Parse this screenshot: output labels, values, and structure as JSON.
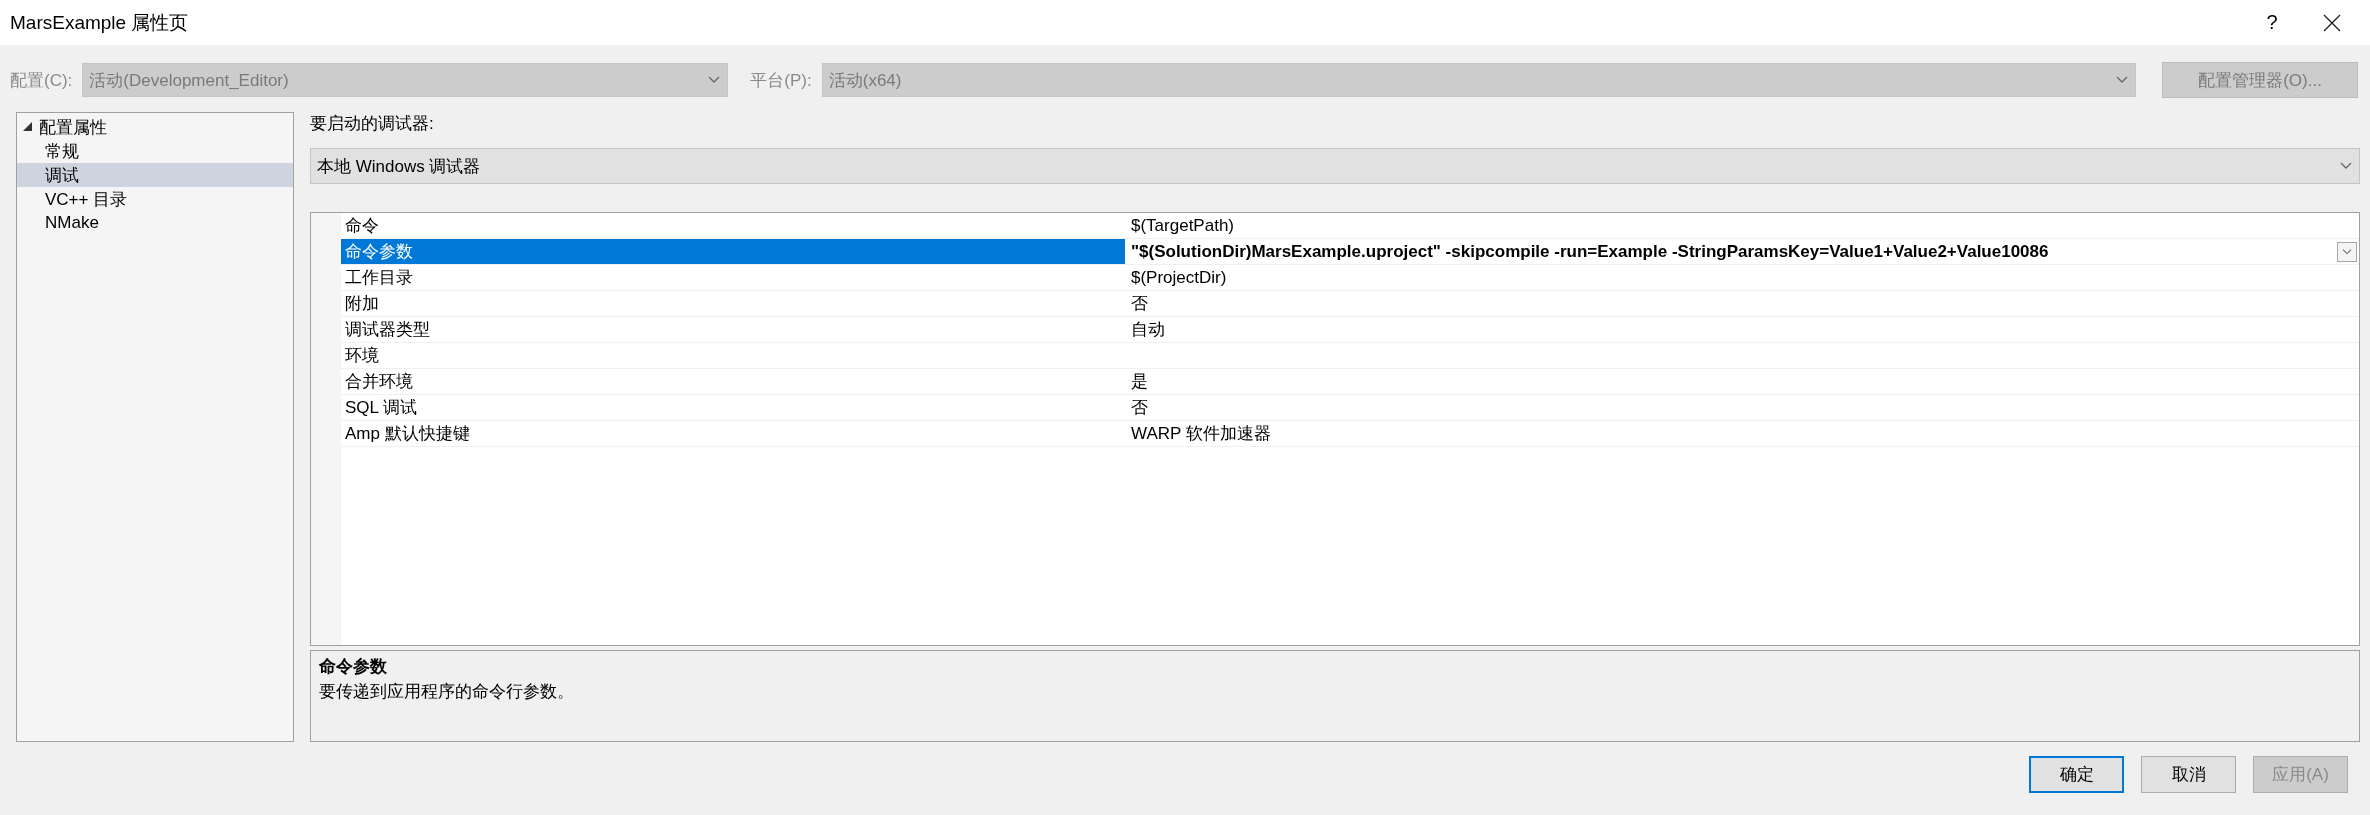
{
  "window": {
    "title": "MarsExample 属性页",
    "help": "?"
  },
  "config_bar": {
    "configuration": {
      "label": "配置(C):",
      "value": "活动(Development_Editor)",
      "disabled": true
    },
    "platform": {
      "label": "平台(P):",
      "value": "活动(x64)",
      "disabled": true
    },
    "manager_button": {
      "label": "配置管理器(O)...",
      "disabled": true
    }
  },
  "sidebar": {
    "items": [
      {
        "label": "配置属性",
        "expanded": true,
        "selected": false,
        "children": [
          {
            "label": "常规",
            "selected": false
          },
          {
            "label": "调试",
            "selected": true
          },
          {
            "label": "VC++ 目录",
            "selected": false
          },
          {
            "label": "NMake",
            "selected": false
          }
        ]
      }
    ]
  },
  "debugger": {
    "label": "要启动的调试器:",
    "value": "本地 Windows 调试器"
  },
  "properties": [
    {
      "name": "命令",
      "value": "$(TargetPath)",
      "selected": false,
      "modified": false
    },
    {
      "name": "命令参数",
      "value": "\"$(SolutionDir)MarsExample.uproject\" -skipcompile -run=Example -StringParamsKey=Value1+Value2+Value10086",
      "selected": true,
      "modified": true
    },
    {
      "name": "工作目录",
      "value": "$(ProjectDir)",
      "selected": false,
      "modified": false
    },
    {
      "name": "附加",
      "value": "否",
      "selected": false,
      "modified": false
    },
    {
      "name": "调试器类型",
      "value": "自动",
      "selected": false,
      "modified": false
    },
    {
      "name": "环境",
      "selected": false
    },
    {
      "name": "合并环境",
      "value": "是",
      "selected": false,
      "modified": false
    },
    {
      "name": "SQL 调试",
      "value": "否",
      "selected": false,
      "modified": false
    },
    {
      "name": "Amp 默认快捷键",
      "value": "WARP 软件加速器",
      "selected": false,
      "modified": false
    }
  ],
  "description": {
    "title": "命令参数",
    "text": "要传递到应用程序的命令行参数。"
  },
  "buttons": [
    {
      "label": "确定",
      "focused": true,
      "disabled": false
    },
    {
      "label": "取消",
      "focused": false,
      "disabled": false
    },
    {
      "label": "应用(A)",
      "focused": false,
      "disabled": true
    }
  ]
}
